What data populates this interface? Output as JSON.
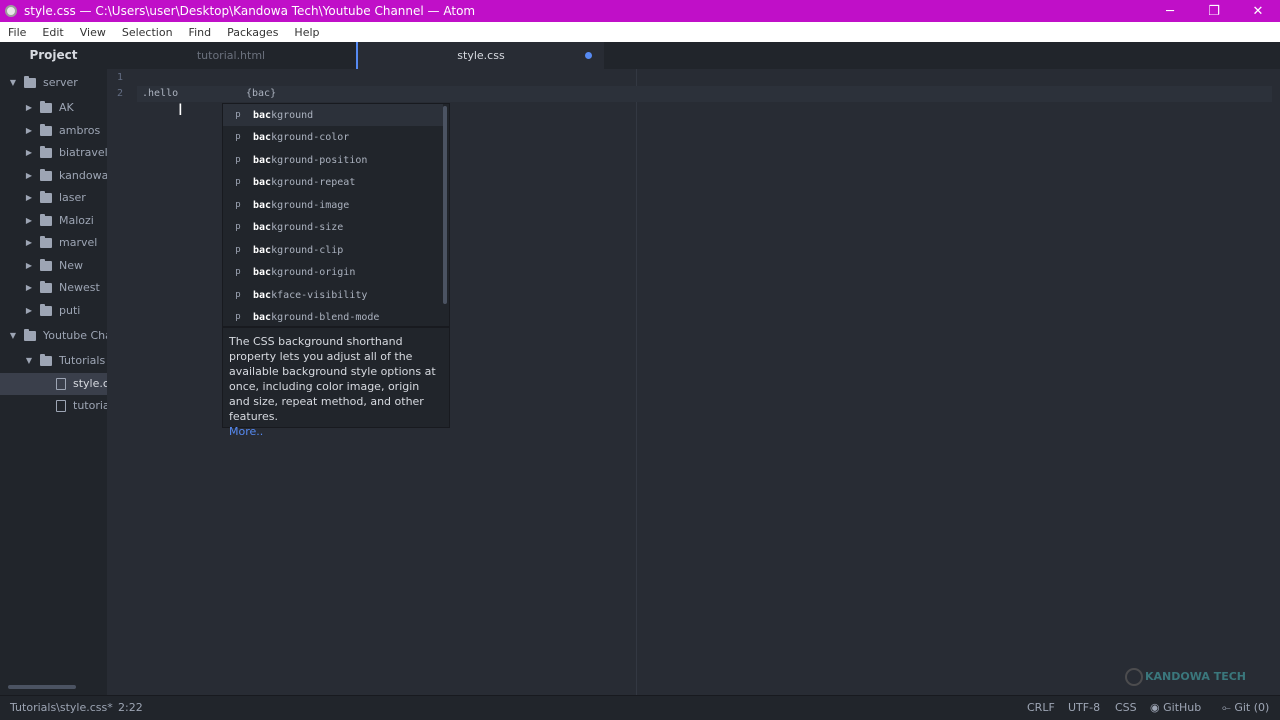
{
  "window": {
    "title": "style.css — C:\\Users\\user\\Desktop\\Kandowa Tech\\Youtube Channel — Atom",
    "minimize": "─",
    "maximize": "❐",
    "close": "✕"
  },
  "menu": [
    "File",
    "Edit",
    "View",
    "Selection",
    "Find",
    "Packages",
    "Help"
  ],
  "tabs": {
    "project": "Project",
    "inactive": "tutorial.html",
    "active": "style.css"
  },
  "sidebar": {
    "server": "server",
    "folders": [
      "AK",
      "ambros",
      "biatravel",
      "kandowa",
      "laser",
      "Malozi",
      "marvel",
      "New",
      "Newest",
      "puti"
    ],
    "youtube": "Youtube Chai",
    "tutorials": "Tutorials",
    "files": [
      "style.cs",
      "tutoria"
    ]
  },
  "editor": {
    "line_numbers": [
      "1",
      "2"
    ],
    "selector": ".hello",
    "brace": "{bac}"
  },
  "autocomplete": {
    "type_letter": "p",
    "prefix": "bac",
    "items": [
      "background",
      "background-color",
      "background-position",
      "background-repeat",
      "background-image",
      "background-size",
      "background-clip",
      "background-origin",
      "backface-visibility",
      "background-blend-mode"
    ],
    "description": "The CSS background shorthand property lets you adjust all of the available background style options at once, including color image, origin and size, repeat method, and other features.",
    "more": "More.."
  },
  "status": {
    "path": "Tutorials\\style.css*",
    "position": "2:22",
    "line_ending": "CRLF",
    "encoding": "UTF-8",
    "grammar": "CSS",
    "github": "GitHub",
    "git": "Git (0)"
  },
  "watermark": "KANDOWA TECH"
}
